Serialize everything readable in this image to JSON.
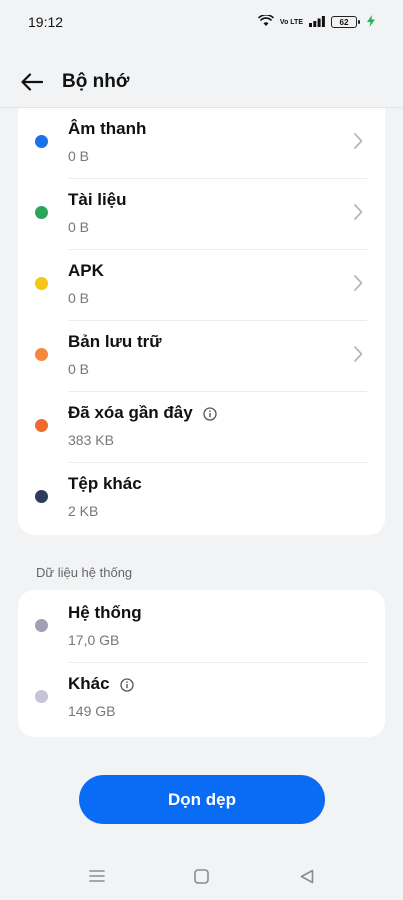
{
  "status": {
    "time": "19:12",
    "battery": "62",
    "volte": "Vo LTE"
  },
  "header": {
    "title": "Bộ nhớ"
  },
  "categories": [
    {
      "name": "Âm thanh",
      "size": "0 B",
      "color": "#1a73e8",
      "chevron": true,
      "info": false
    },
    {
      "name": "Tài liệu",
      "size": "0 B",
      "color": "#2aa55a",
      "chevron": true,
      "info": false
    },
    {
      "name": "APK",
      "size": "0 B",
      "color": "#f5c518",
      "chevron": true,
      "info": false
    },
    {
      "name": "Bản lưu trữ",
      "size": "0 B",
      "color": "#f6873c",
      "chevron": true,
      "info": false
    },
    {
      "name": "Đã xóa gần đây",
      "size": "383 KB",
      "color": "#ef6a2e",
      "chevron": false,
      "info": true
    },
    {
      "name": "Tệp khác",
      "size": "2 KB",
      "color": "#2f3b5c",
      "chevron": false,
      "info": false
    }
  ],
  "system_section": {
    "label": "Dữ liệu hệ thống",
    "items": [
      {
        "name": "Hệ thống",
        "size": "17,0 GB",
        "color": "#9fa0b3",
        "info": false
      },
      {
        "name": "Khác",
        "size": "149 GB",
        "color": "#c5c4d9",
        "info": true
      }
    ]
  },
  "actions": {
    "clean_label": "Dọn dẹp"
  },
  "colors": {
    "accent": "#0a6cf5",
    "background": "#f2f3f5"
  }
}
